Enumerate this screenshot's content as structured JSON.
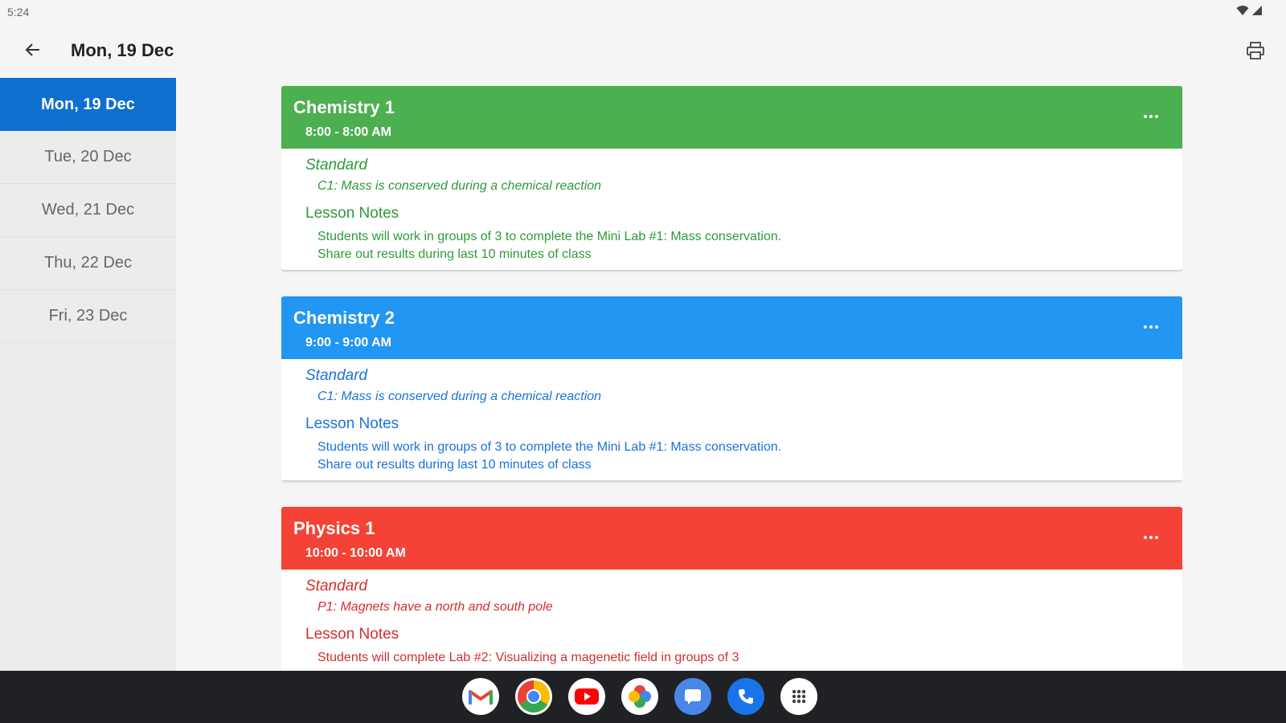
{
  "status": {
    "time": "5:24"
  },
  "appbar": {
    "title": "Mon, 19 Dec"
  },
  "sidebar": {
    "days": [
      {
        "label": "Mon, 19 Dec",
        "active": true
      },
      {
        "label": "Tue, 20 Dec",
        "active": false
      },
      {
        "label": "Wed, 21 Dec",
        "active": false
      },
      {
        "label": "Thu, 22 Dec",
        "active": false
      },
      {
        "label": "Fri, 23 Dec",
        "active": false
      }
    ]
  },
  "lessons": [
    {
      "name": "Chemistry 1",
      "time": "8:00 - 8:00 AM",
      "color": "#4caf50",
      "text_color": "#2e9a3a",
      "standard_label": "Standard",
      "standard": "C1: Mass is conserved during a chemical reaction",
      "notes_label": "Lesson Notes",
      "notes": [
        "Students will work in groups of 3 to complete the Mini Lab #1: Mass conservation.",
        "Share out results during last 10 minutes of class"
      ]
    },
    {
      "name": "Chemistry 2",
      "time": "9:00 - 9:00 AM",
      "color": "#2196f3",
      "text_color": "#1a73d9",
      "standard_label": "Standard",
      "standard": "C1: Mass is conserved during a chemical reaction",
      "notes_label": "Lesson Notes",
      "notes": [
        "Students will work in groups of 3 to complete the Mini Lab #1: Mass conservation.",
        "Share out results during last 10 minutes of class"
      ]
    },
    {
      "name": "Physics 1",
      "time": "10:00 - 10:00 AM",
      "color": "#f44336",
      "text_color": "#d32f2f",
      "standard_label": "Standard",
      "standard": "P1: Magnets have a north and south pole",
      "notes_label": "Lesson Notes",
      "notes": [
        "Students will complete Lab #2: Visualizing a magenetic field in groups of 3"
      ]
    }
  ],
  "dock": {
    "apps": [
      {
        "icon": "gmail-icon"
      },
      {
        "icon": "chrome-icon"
      },
      {
        "icon": "youtube-icon"
      },
      {
        "icon": "photos-icon"
      },
      {
        "icon": "messages-icon"
      },
      {
        "icon": "phone-icon"
      },
      {
        "icon": "app-launcher-icon"
      }
    ]
  },
  "colors": {
    "accent": "#0f6fcf",
    "taskbar": "#202124"
  }
}
